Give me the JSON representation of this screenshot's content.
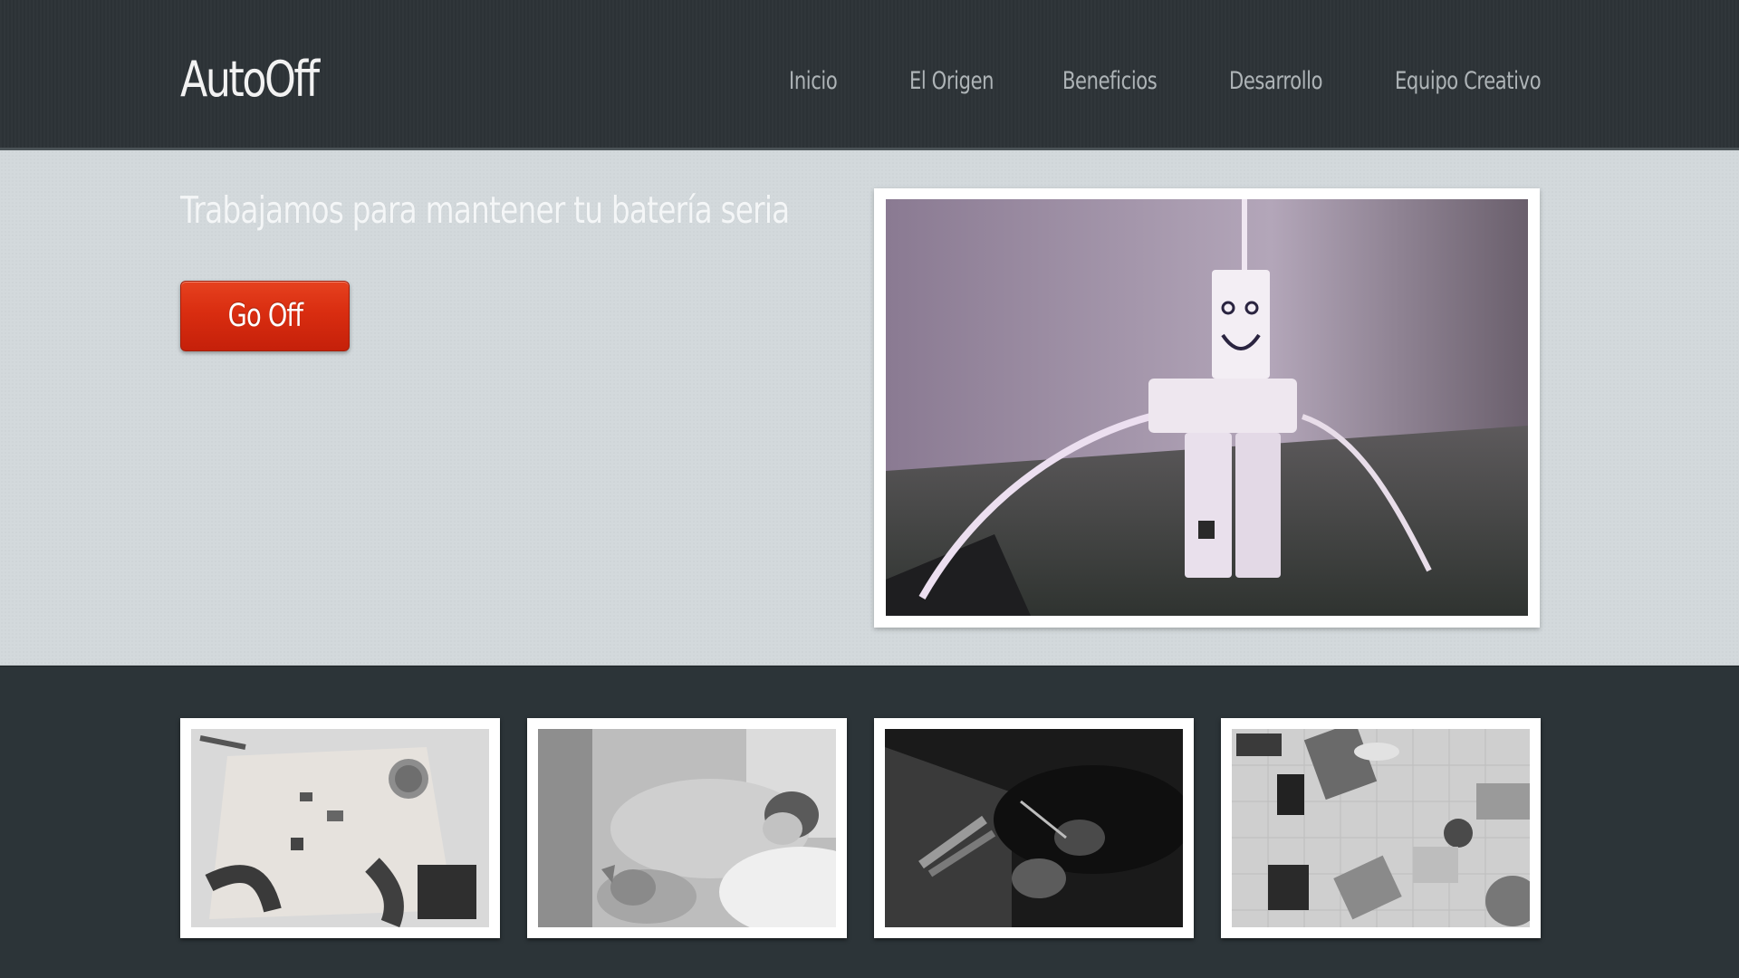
{
  "brand": {
    "logo_text": "AutoOff"
  },
  "nav": {
    "items": [
      {
        "label": "Inicio"
      },
      {
        "label": "El Origen"
      },
      {
        "label": "Beneficios"
      },
      {
        "label": "Desarrollo"
      },
      {
        "label": "Equipo Creativo"
      }
    ]
  },
  "hero": {
    "tagline": "Trabajamos para mantener tu batería seria",
    "cta_label": "Go Off",
    "image": {
      "description": "smiling charger robot",
      "icon": "robot-charger-photo"
    }
  },
  "gallery": {
    "items": [
      {
        "icon": "electronics-workbench-photo"
      },
      {
        "icon": "sleeping-with-dog-photo"
      },
      {
        "icon": "soldering-tools-photo"
      },
      {
        "icon": "team-meeting-laptops-photo"
      }
    ]
  },
  "colors": {
    "header_bg": "#2d3337",
    "hero_bg": "#d3d9dc",
    "gallery_bg": "#2c3438",
    "cta_red": "#d92d10",
    "nav_text": "#aeb4b7",
    "logo_text": "#f2f2f2"
  }
}
